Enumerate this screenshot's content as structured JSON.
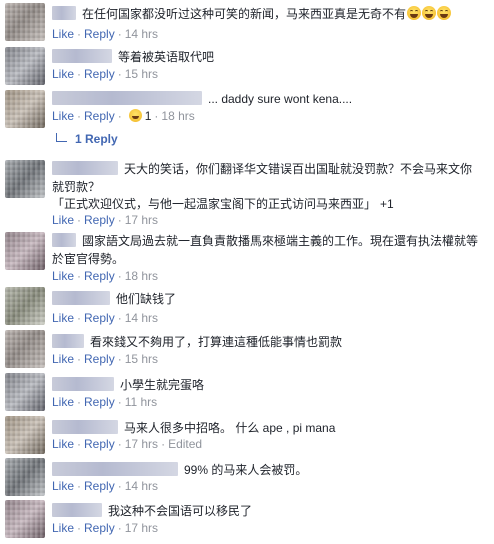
{
  "actions": {
    "like": "Like",
    "reply": "Reply",
    "dot": "·"
  },
  "comments": [
    {
      "text": "在任何国家都没听过这种可笑的新闻，马来西亚真是无奇不有",
      "time": "14 hrs",
      "emoji_after_text": [
        "grinning-squint-emoji",
        "grinning-squint-emoji",
        "grinning-squint-emoji"
      ]
    },
    {
      "text": "等着被英语取代吧",
      "time": "15 hrs"
    },
    {
      "text": "... daddy sure wont kena....",
      "time": "18 hrs",
      "reaction_count": "1",
      "reaction_icon": "haha-reaction-icon"
    },
    {
      "text": "天大的笑话，你们翻译华文错误百出国耻就没罚款？不会马来文你就罚款？",
      "quote": "「正式欢迎仪式，与他一起温家宝阁下的正式访问马来西亚」",
      "quote_extra": "+1",
      "time": "17 hrs"
    },
    {
      "text": "國家語文局過去就一直負責散播馬來極端主義的工作。現在還有执法權就等於宦官得勢。",
      "time": "18 hrs"
    },
    {
      "text": "他们缺钱了",
      "time": "14 hrs"
    },
    {
      "text": "看來錢又不夠用了，打算連這種低能事情也罰款",
      "time": "15 hrs"
    },
    {
      "text": "小學生就完蛋咯",
      "time": "11 hrs"
    },
    {
      "text": "马来人很多中招咯。 什么 ape , pi mana",
      "time": "17 hrs",
      "edited": "Edited"
    },
    {
      "text": "99% 的马来人会被罚。",
      "time": "14 hrs"
    },
    {
      "text": "我这种不会国语可以移民了",
      "time": "17 hrs"
    }
  ],
  "reply_thread": {
    "label": "1 Reply"
  },
  "colors": {
    "link": "#4267b2",
    "meta": "#90949c",
    "text": "#1d2129"
  }
}
